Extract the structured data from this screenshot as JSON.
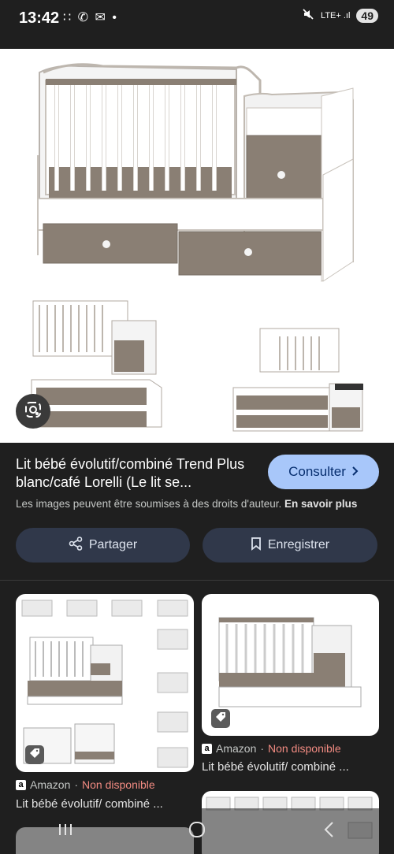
{
  "status_bar": {
    "time": "13:42",
    "left_icons": "∷ ✆ ✉ •",
    "right_icons": "LTE+ .ıl",
    "battery": "49"
  },
  "product": {
    "title": "Lit bébé évolutif/combiné Trend Plus blanc/café Lorelli (Le lit se...",
    "consult_label": "Consulter",
    "copyright_text": "Les images peuvent être soumises à des droits d'auteur.",
    "learn_more": "En savoir plus",
    "share_label": "Partager",
    "save_label": "Enregistrer"
  },
  "related": [
    {
      "source": "Amazon",
      "separator": "·",
      "availability": "Non disponible",
      "title": "Lit bébé évolutif/ combiné ..."
    },
    {
      "source": "Amazon",
      "separator": "·",
      "availability": "Non disponible",
      "title": "Lit bébé évolutif/ combiné ..."
    }
  ],
  "colors": {
    "background": "#1f1f1f",
    "consult_button": "#a8c7fa",
    "action_button": "#30384a",
    "unavailable": "#f28b82",
    "wood": "#8a7f74"
  },
  "icons": [
    "lens-icon",
    "share-icon",
    "bookmark-icon",
    "tag-icon",
    "chevron-right-icon",
    "nav-recents-icon",
    "nav-home-icon",
    "nav-back-icon"
  ]
}
